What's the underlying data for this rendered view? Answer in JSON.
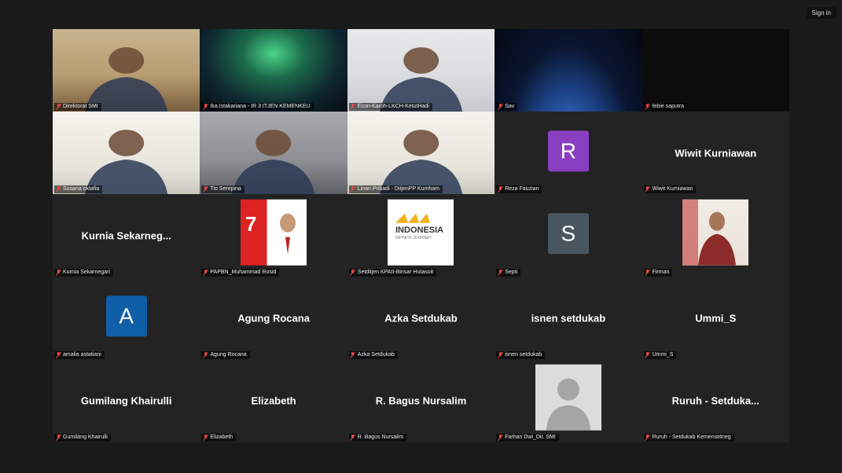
{
  "topbar": {
    "sign_in_label": "Sign in"
  },
  "tiles": [
    {
      "type": "video",
      "scene": "office",
      "name": "Direktorat SMI"
    },
    {
      "type": "video",
      "scene": "aurora",
      "name": "Ika Istakariana - IR 3 ITJEN KEMENKEU"
    },
    {
      "type": "video",
      "scene": "speaker",
      "name": "Econ-Karoh-LKCH-KetutHadi",
      "active": true
    },
    {
      "type": "video",
      "scene": "earth",
      "name": "Sav"
    },
    {
      "type": "video",
      "scene": "black",
      "name": "febie saputra"
    },
    {
      "type": "video",
      "scene": "poster",
      "name": "Susana oktafia"
    },
    {
      "type": "video",
      "scene": "room",
      "name": "Tio Serepina"
    },
    {
      "type": "video",
      "scene": "poster",
      "name": "Linan Pribadi - DitjenPP Kumham"
    },
    {
      "type": "avatar",
      "letter": "R",
      "color": "#8a3fc1",
      "name": "Reza Fauzian"
    },
    {
      "type": "text",
      "display": "Wiwit Kurniawan",
      "name": "Wiwit Kurniawan"
    },
    {
      "type": "text",
      "display": "Kurnia Sekarneg...",
      "name": "Kurnia Sekarnegari"
    },
    {
      "type": "picture",
      "pic": "flyer",
      "name": "PAPBN_Muhammad Rosid"
    },
    {
      "type": "picture",
      "pic": "logo",
      "name": "Setditjen KPAII-Binsar Hutasoit"
    },
    {
      "type": "avatar",
      "letter": "S",
      "color": "#4a5660",
      "name": "Septi"
    },
    {
      "type": "picture",
      "pic": "photo",
      "name": "Firman"
    },
    {
      "type": "avatar",
      "letter": "A",
      "color": "#0f5fa8",
      "name": "amalia astatiani"
    },
    {
      "type": "text",
      "display": "Agung Rocana",
      "name": "Agung Rocana"
    },
    {
      "type": "text",
      "display": "Azka Setdukab",
      "name": "Azka Setdukab"
    },
    {
      "type": "text",
      "display": "isnen setdukab",
      "name": "isnen setdukab"
    },
    {
      "type": "text",
      "display": "Ummi_S",
      "name": "Ummi_S"
    },
    {
      "type": "text",
      "display": "Gumilang Khairulli",
      "name": "Gumilang Khairulli"
    },
    {
      "type": "text",
      "display": "Elizabeth",
      "name": "Elizabeth"
    },
    {
      "type": "text",
      "display": "R. Bagus Nursalim",
      "name": "R. Bagus Nursalim"
    },
    {
      "type": "picture",
      "pic": "default",
      "name": "Farhan Dwi_Dit. SMI"
    },
    {
      "type": "text",
      "display": "Ruruh - Setduka...",
      "name": "Ruruh - Setdukab Kemensetneg"
    }
  ],
  "picture_texts": {
    "logo_title": "INDONESIA",
    "logo_sub": "INFINITE JOURNEY"
  },
  "icons": {
    "mic_muted": "mic-muted-icon"
  }
}
